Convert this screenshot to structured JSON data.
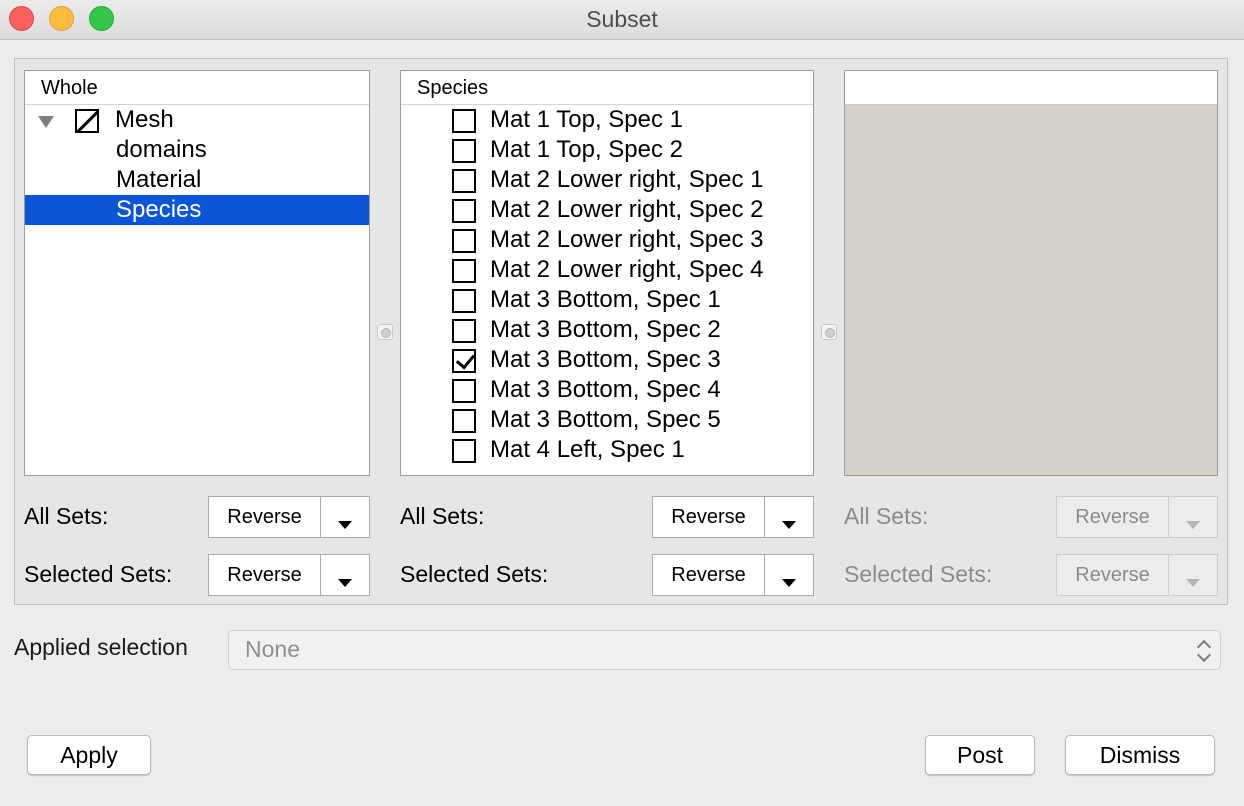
{
  "window": {
    "title": "Subset"
  },
  "panels": {
    "whole": {
      "header": "Whole",
      "tree": [
        {
          "label": "Mesh",
          "level": 0,
          "expanded": true,
          "check_state": "partial",
          "selected": false
        },
        {
          "label": "domains",
          "level": 1,
          "selected": false
        },
        {
          "label": "Material",
          "level": 1,
          "selected": false
        },
        {
          "label": "Species",
          "level": 1,
          "selected": true
        }
      ]
    },
    "species": {
      "header": "Species",
      "items": [
        {
          "label": "Mat 1 Top, Spec 1",
          "checked": false
        },
        {
          "label": "Mat 1 Top, Spec 2",
          "checked": false
        },
        {
          "label": "Mat 2 Lower right, Spec 1",
          "checked": false
        },
        {
          "label": "Mat 2 Lower right, Spec 2",
          "checked": false
        },
        {
          "label": "Mat 2 Lower right, Spec 3",
          "checked": false
        },
        {
          "label": "Mat 2 Lower right, Spec 4",
          "checked": false
        },
        {
          "label": "Mat 3 Bottom, Spec 1",
          "checked": false
        },
        {
          "label": "Mat 3 Bottom, Spec 2",
          "checked": false
        },
        {
          "label": "Mat 3 Bottom, Spec 3",
          "checked": true
        },
        {
          "label": "Mat 3 Bottom, Spec 4",
          "checked": false
        },
        {
          "label": "Mat 3 Bottom, Spec 5",
          "checked": false
        },
        {
          "label": "Mat 4 Left, Spec 1",
          "checked": false
        }
      ]
    },
    "third": {
      "header": "",
      "enabled": false
    }
  },
  "controls": {
    "all_sets_label": "All Sets:",
    "selected_sets_label": "Selected Sets:",
    "reverse_label": "Reverse"
  },
  "applied_selection": {
    "label": "Applied selection",
    "value": "None"
  },
  "buttons": {
    "apply": "Apply",
    "post": "Post",
    "dismiss": "Dismiss"
  },
  "colors": {
    "selection": "#0c55d6",
    "close": "#fc605b",
    "minimize": "#fdbc40",
    "maximize": "#34c84a",
    "disabled_panel": "#d4d0ca"
  }
}
